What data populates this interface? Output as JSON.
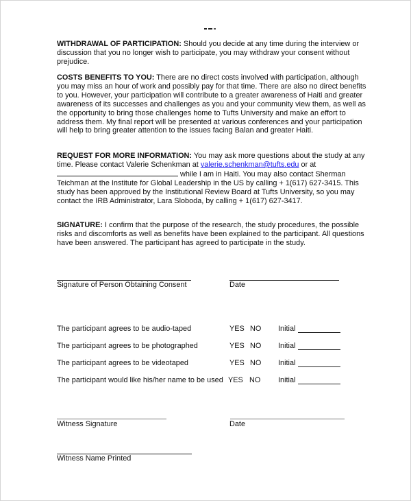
{
  "document": {
    "clipped_header_fragment": "",
    "withdrawal": {
      "heading": "WITHDRAWAL OF PARTICIPATION:",
      "text": "  Should you decide at any time during the interview or discussion that you no longer wish to participate, you may withdraw your consent without prejudice."
    },
    "costs": {
      "heading": "COSTS BENEFITS TO YOU:",
      "text": "  There are no direct costs involved with participation, although you may miss an hour of work and possibly pay for that time. There are also no direct benefits to you. However, your participation will contribute to a greater awareness of Haiti and greater awareness of its successes and challenges as you and your community view them, as well as the opportunity to bring those challenges home to Tufts University and make an effort to address them. My final report will be presented at various conferences and your participation will help to bring greater attention to the issues facing Balan and greater Haiti."
    },
    "request_info": {
      "heading": "REQUEST FOR MORE INFORMATION:",
      "text_before_link": " You may ask more questions about the study at any time.  Please contact Valerie Schenkman at ",
      "email_link": "valerie.schenkman@tufts.edu",
      "text_after_link": " or at ",
      "text_after_blank": " while I am in Haiti. You may also contact Sherman Teichman at the Institute for Global Leadership in the US by calling + 1(617) 627-3415. This study has been approved by the Institutional Review Board at Tufts University, so you may contact the IRB Administrator, Lara Sloboda, by calling + 1(617) 627-3417."
    },
    "signature": {
      "heading": "SIGNATURE:",
      "text": " I confirm that the purpose of the research, the study procedures, the possible risks and discomforts as well as benefits have been explained to the participant. All questions have been answered. The participant has agreed to participate in the study."
    },
    "consent_signature_label": "Signature of Person Obtaining Consent",
    "consent_date_label": "Date",
    "agreements": [
      {
        "statement": "The participant agrees to be audio-taped",
        "yes": "YES",
        "no": "NO",
        "initial": "Initial"
      },
      {
        "statement": "The participant agrees to be photographed",
        "yes": "YES",
        "no": "NO",
        "initial": "Initial"
      },
      {
        "statement": "The participant agrees to be videotaped",
        "yes": "YES",
        "no": "NO",
        "initial": "Initial"
      },
      {
        "statement": "The participant would like his/her name to be used",
        "yes": "YES",
        "no": "NO",
        "initial": "Initial"
      }
    ],
    "witness_signature_label": "Witness Signature",
    "witness_date_label": "Date",
    "witness_name_label": "Witness Name Printed"
  }
}
